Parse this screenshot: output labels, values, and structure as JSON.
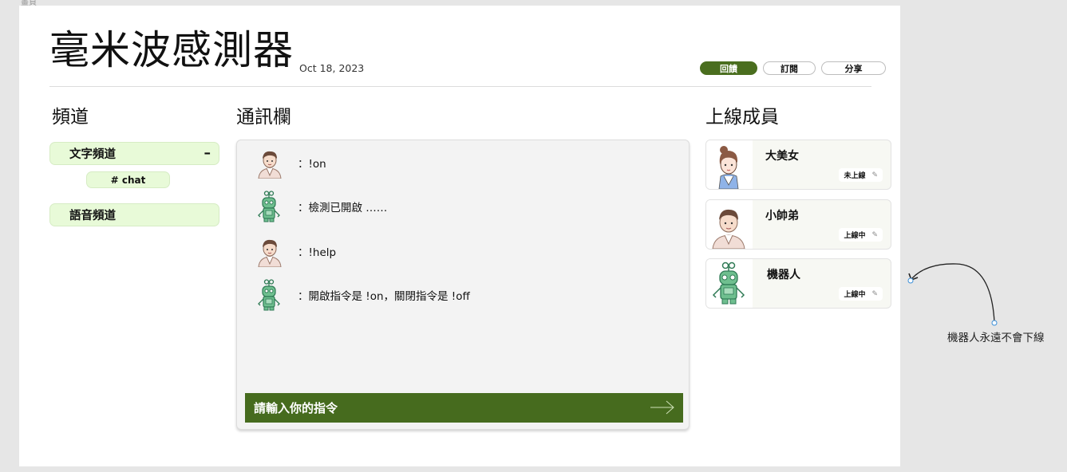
{
  "page": {
    "title": "毫米波感測器",
    "date": "Oct 18, 2023",
    "actions": {
      "feedback": "回饋",
      "subscribe": "訂閱",
      "share": "分享"
    }
  },
  "channels": {
    "heading": "頻道",
    "text_channel": "文字頻道",
    "collapse_symbol": "–",
    "sub_channel": "# chat",
    "voice_channel": "語音頻道"
  },
  "chat": {
    "heading": "通訊欄",
    "messages": [
      {
        "sender": "user",
        "text": "：!on"
      },
      {
        "sender": "robot",
        "text": "：檢測已開啟 ……"
      },
      {
        "sender": "user",
        "text": "：!help"
      },
      {
        "sender": "robot",
        "text": "：開啟指令是 !on，關閉指令是 !off"
      }
    ],
    "input_placeholder": "請輸入你的指令"
  },
  "members": {
    "heading": "上線成員",
    "list": [
      {
        "name": "大美女",
        "status": "未上線",
        "avatar": "woman-avatar"
      },
      {
        "name": "小帥弟",
        "status": "上線中",
        "avatar": "man-avatar"
      },
      {
        "name": "機器人",
        "status": "上線中",
        "avatar": "robot-avatar"
      }
    ]
  },
  "annotation": {
    "text": "機器人永遠不會下線"
  },
  "colors": {
    "accent": "#466b1e",
    "channel_bg": "#e8fad8",
    "robot": "#6fbf8f"
  }
}
